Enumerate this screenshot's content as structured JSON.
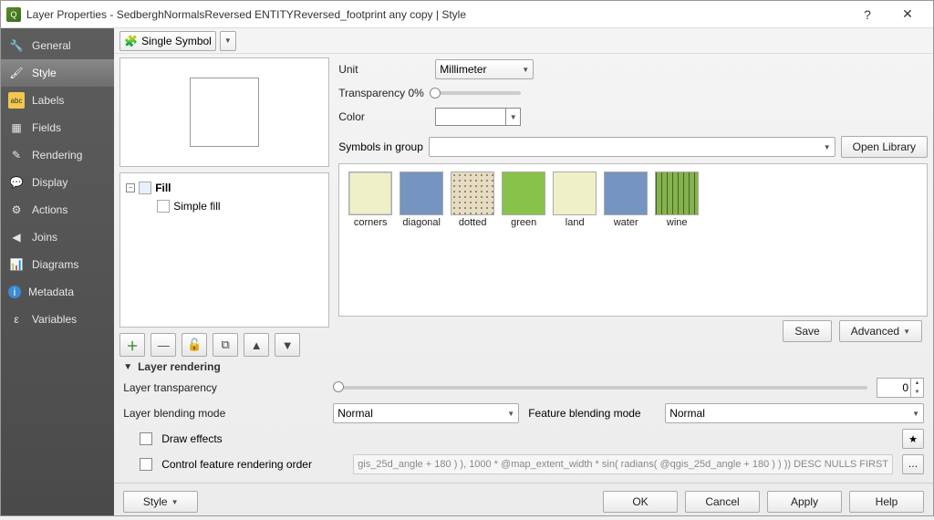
{
  "window": {
    "title": "Layer Properties - SedberghNormalsReversed ENTITYReversed_footprint any copy | Style",
    "help_mark": "?",
    "close_mark": "✕"
  },
  "sidebar": {
    "items": [
      {
        "label": "General",
        "icon": "🔧"
      },
      {
        "label": "Style",
        "icon": "🖌"
      },
      {
        "label": "Labels",
        "icon": "abc"
      },
      {
        "label": "Fields",
        "icon": "▦"
      },
      {
        "label": "Rendering",
        "icon": "✎"
      },
      {
        "label": "Display",
        "icon": "💬"
      },
      {
        "label": "Actions",
        "icon": "⚙"
      },
      {
        "label": "Joins",
        "icon": "🔗"
      },
      {
        "label": "Diagrams",
        "icon": "📊"
      },
      {
        "label": "Metadata",
        "icon": "ℹ"
      },
      {
        "label": "Variables",
        "icon": "ε"
      }
    ],
    "active_index": 1
  },
  "symbol_dropdown": {
    "label": "Single Symbol"
  },
  "tree": {
    "root_label": "Fill",
    "child_label": "Simple fill"
  },
  "tool_buttons": {
    "labels": [
      "add",
      "remove",
      "lock",
      "duplicate",
      "up",
      "down"
    ],
    "glyphs": [
      "➕",
      "➖",
      "🔓",
      "⧉",
      "▲",
      "▼"
    ]
  },
  "form": {
    "unit_label": "Unit",
    "unit_value": "Millimeter",
    "transparency_label": "Transparency 0%",
    "color_label": "Color"
  },
  "sym_group": {
    "label": "Symbols in group",
    "open_library": "Open Library"
  },
  "symbols": [
    {
      "name": "corners",
      "cls": "sw-corners"
    },
    {
      "name": "diagonal",
      "cls": "sw-diag"
    },
    {
      "name": "dotted",
      "cls": "sw-dotted"
    },
    {
      "name": "green",
      "cls": "sw-green"
    },
    {
      "name": "land",
      "cls": "sw-land"
    },
    {
      "name": "water",
      "cls": "sw-water"
    },
    {
      "name": "wine",
      "cls": "sw-wine"
    }
  ],
  "save_row": {
    "save": "Save",
    "advanced": "Advanced"
  },
  "render": {
    "header": "Layer rendering",
    "transparency_label": "Layer transparency",
    "transparency_value": "0",
    "layer_blend_label": "Layer blending mode",
    "feature_blend_label": "Feature blending mode",
    "blend_value": "Normal",
    "draw_effects": "Draw effects",
    "control_order": "Control feature rendering order",
    "expression": "gis_25d_angle + 180 ) ),   1000 * @map_extent_width * sin( radians( @qgis_25d_angle + 180 ) ) )) DESC NULLS FIRST"
  },
  "footer": {
    "style": "Style",
    "ok": "OK",
    "cancel": "Cancel",
    "apply": "Apply",
    "help": "Help"
  }
}
